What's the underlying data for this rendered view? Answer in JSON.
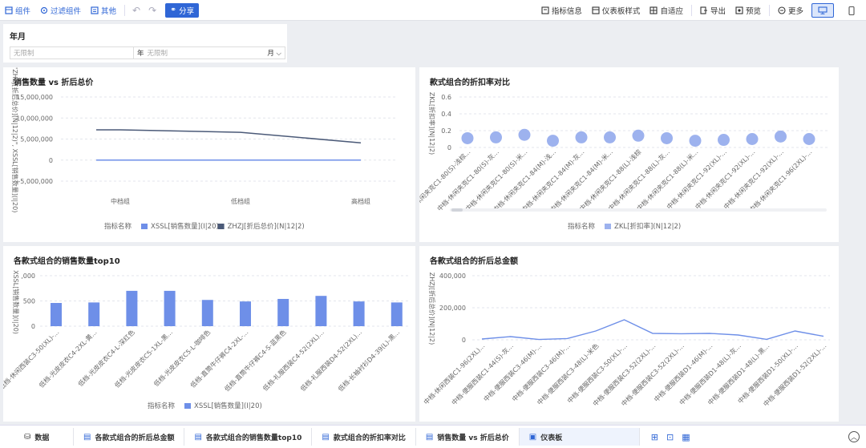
{
  "toolbar": {
    "component": "组件",
    "filter_component": "过滤组件",
    "other": "其他",
    "share": "分享",
    "metric_info": "指标信息",
    "dashboard_style": "仪表板样式",
    "adaptive": "自适应",
    "export": "导出",
    "preview": "预览",
    "more": "更多"
  },
  "filter": {
    "title": "年月",
    "start_placeholder": "无限制",
    "year_label": "年",
    "end_placeholder": "无限制",
    "month_label": "月"
  },
  "panels": {
    "p1_title": "销售数量 vs 折后总价",
    "p2_title": "款式组合的折扣率对比",
    "p3_title": "各款式组合的销售数量top10",
    "p4_title": "各款式组合的折后总金额"
  },
  "chart_data": [
    {
      "type": "line",
      "title": "销售数量 vs 折后总价",
      "ylabel": "\"ZHZJ[折后总价](N|12|2)\", XSSL[销售数量](I|20)",
      "categories": [
        "中档组",
        "低档组",
        "高档组"
      ],
      "y_ticks": [
        "15,000,000",
        "10,000,000",
        "5,000,000",
        "0",
        "-5,000,000"
      ],
      "ylim": [
        -5000000,
        15000000
      ],
      "legend_title": "指标名称",
      "series": [
        {
          "name": "XSSL[销售数量](I|20)",
          "color": "#6e8fe8",
          "values": [
            0,
            0,
            0
          ]
        },
        {
          "name": "ZHZJ[折后总价](N|12|2)",
          "color": "#4b5a78",
          "values": [
            7200000,
            6600000,
            4100000
          ]
        }
      ]
    },
    {
      "type": "scatter",
      "title": "款式组合的折扣率对比",
      "ylabel": "ZKL[折扣率](N|12|2)",
      "y_ticks": [
        "0.6",
        "0.4",
        "0.2",
        "0"
      ],
      "ylim": [
        0,
        0.6
      ],
      "legend_title": "指标名称",
      "series": [
        {
          "name": "ZKL[折扣率](N|12|2)",
          "color": "#9db2ee"
        }
      ],
      "categories": [
        "中档-休闲夹克C1-80(S)-浅棕...",
        "中档-休闲夹克C1-80(S)-灰...",
        "中档-休闲夹克C1-80(S)-米...",
        "中档-休闲夹克C1-84(M)-浅...",
        "中档-休闲夹克C1-84(M)-灰...",
        "中档-休闲夹克C1-84(M)-米...",
        "中档-休闲夹克C1-88(L)-浅棕",
        "中档-休闲夹克C1-88(L)-灰...",
        "中档-休闲夹克C1-88(L)-米...",
        "中档-休闲夹克C1-92(XL)-...",
        "中档-休闲夹克C1-92(XL)-...",
        "中档-休闲夹克C1-92(XL)-...",
        "中档-休闲夹克C1-96(2XL)-..."
      ],
      "values": [
        0.11,
        0.12,
        0.15,
        0.08,
        0.12,
        0.12,
        0.14,
        0.11,
        0.08,
        0.09,
        0.1,
        0.13,
        0.1
      ]
    },
    {
      "type": "bar",
      "title": "各款式组合的销售数量top10",
      "ylabel": "XSSL[销售数量](I|20)",
      "y_ticks": [
        ",000",
        "500",
        "0"
      ],
      "ylim": [
        0,
        1000
      ],
      "legend_title": "指标名称",
      "series": [
        {
          "name": "XSSL[销售数量](I|20)",
          "color": "#6e8fe8"
        }
      ],
      "categories": [
        "低档-休闲西装C3-50(XL)-...",
        "低档-光皮皮衣C4-2XL-黄...",
        "低档-光皮皮衣C4-L-深红色",
        "低档-光皮皮衣C5-1XL-黑...",
        "低档-光皮皮衣C5-L-咖啡色",
        "低档-直筒牛仔裤C4-2XL-...",
        "低档-直筒牛仔裤C4-S-蓝黑色",
        "低档-礼服西装C4-52(2XL)...",
        "低档-礼服西装D4-52(2XL)...",
        "低档-长袖衬衫D4-39(L)-黑..."
      ],
      "values": [
        460,
        470,
        700,
        700,
        520,
        490,
        540,
        600,
        490,
        470
      ]
    },
    {
      "type": "line",
      "title": "各款式组合的折后总金额",
      "ylabel": "ZHZJ[折后总价](N|12|2)",
      "y_ticks": [
        "400,000",
        "200,000",
        "0"
      ],
      "ylim": [
        0,
        400000
      ],
      "series": [
        {
          "name": "ZHZJ[折后总价](N|12|2)",
          "color": "#6e8fe8"
        }
      ],
      "categories": [
        "中档-休闲西装C1-96(2XL)...",
        "中档-便服西装C1-44(S)-灰...",
        "中档-便服西装C3-46(M)-...",
        "中档-便服西装C3-46(M)-...",
        "中档-便服西装C3-48(L)-米色",
        "中档-便服西装C3-50(XL)-...",
        "中档-便服西装C3-52(2XL)-...",
        "中档-便服西装C3-52(2XL)-...",
        "中档-便服西装D1-46(M)-...",
        "中档-便服西装D1-48(L)-灰...",
        "中档-便服西装D1-48(L)-黑...",
        "中档-便服西装D1-50(XL)-...",
        "中档-便服西装D1-52(2XL)-..."
      ],
      "values": [
        5000,
        20000,
        2000,
        8000,
        55000,
        125000,
        40000,
        38000,
        40000,
        30000,
        3000,
        55000,
        22000
      ]
    }
  ],
  "tabs": [
    {
      "label": "数据",
      "icon": "database-icon"
    },
    {
      "label": "各款式组合的折后总金额",
      "icon": "table-icon"
    },
    {
      "label": "各款式组合的销售数量top10",
      "icon": "table-icon"
    },
    {
      "label": "款式组合的折扣率对比",
      "icon": "table-icon"
    },
    {
      "label": "销售数量 vs 折后总价",
      "icon": "table-icon"
    },
    {
      "label": "仪表板",
      "icon": "dashboard-icon"
    }
  ],
  "colors": {
    "accent": "#2f66d6",
    "series_blue": "#6e8fe8",
    "series_dark": "#4b5a78",
    "scatter": "#9db2ee"
  }
}
